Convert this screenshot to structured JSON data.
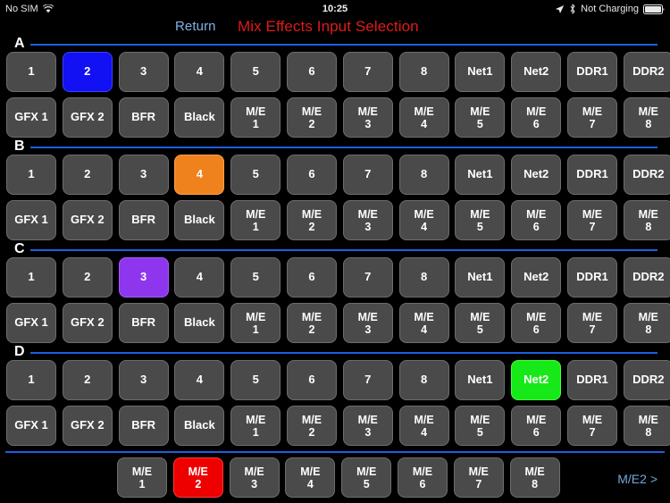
{
  "status_bar": {
    "carrier": "No SIM",
    "wifi_icon": "wifi-icon",
    "time": "10:25",
    "location_icon": "location-arrow-icon",
    "bluetooth_icon": "bluetooth-icon",
    "charging_status": "Not Charging",
    "battery_icon": "battery-icon"
  },
  "header": {
    "return_label": "Return",
    "title": "Mix Effects Input Selection",
    "return_color": "#7fb2e5",
    "title_color": "#e01a1a"
  },
  "theme": {
    "background": "#000000",
    "button_fill": "#4a4a4a",
    "button_border": "#6d6d6d",
    "rule_color": "#1c5fe0",
    "sel_blue": "#1111f4",
    "sel_orange": "#f0821e",
    "sel_purple": "#8e36ee",
    "sel_green": "#17e817",
    "sel_red": "#ee0000"
  },
  "sections": [
    {
      "label": "A",
      "row1": [
        {
          "label": "1",
          "state": "off"
        },
        {
          "label": "2",
          "state": "blue"
        },
        {
          "label": "3",
          "state": "off"
        },
        {
          "label": "4",
          "state": "off"
        },
        {
          "label": "5",
          "state": "off"
        },
        {
          "label": "6",
          "state": "off"
        },
        {
          "label": "7",
          "state": "off"
        },
        {
          "label": "8",
          "state": "off"
        },
        {
          "label": "Net1",
          "state": "off"
        },
        {
          "label": "Net2",
          "state": "off"
        },
        {
          "label": "DDR1",
          "state": "off"
        },
        {
          "label": "DDR2",
          "state": "off"
        }
      ],
      "row2": [
        {
          "label": "GFX 1",
          "state": "off"
        },
        {
          "label": "GFX 2",
          "state": "off"
        },
        {
          "label": "BFR",
          "state": "off"
        },
        {
          "label": "Black",
          "state": "off"
        },
        {
          "label": "M/E\n1",
          "state": "off"
        },
        {
          "label": "M/E\n2",
          "state": "off"
        },
        {
          "label": "M/E\n3",
          "state": "off"
        },
        {
          "label": "M/E\n4",
          "state": "off"
        },
        {
          "label": "M/E\n5",
          "state": "off"
        },
        {
          "label": "M/E\n6",
          "state": "off"
        },
        {
          "label": "M/E\n7",
          "state": "off"
        },
        {
          "label": "M/E\n8",
          "state": "off"
        }
      ]
    },
    {
      "label": "B",
      "row1": [
        {
          "label": "1",
          "state": "off"
        },
        {
          "label": "2",
          "state": "off"
        },
        {
          "label": "3",
          "state": "off"
        },
        {
          "label": "4",
          "state": "orange"
        },
        {
          "label": "5",
          "state": "off"
        },
        {
          "label": "6",
          "state": "off"
        },
        {
          "label": "7",
          "state": "off"
        },
        {
          "label": "8",
          "state": "off"
        },
        {
          "label": "Net1",
          "state": "off"
        },
        {
          "label": "Net2",
          "state": "off"
        },
        {
          "label": "DDR1",
          "state": "off"
        },
        {
          "label": "DDR2",
          "state": "off"
        }
      ],
      "row2": [
        {
          "label": "GFX 1",
          "state": "off"
        },
        {
          "label": "GFX 2",
          "state": "off"
        },
        {
          "label": "BFR",
          "state": "off"
        },
        {
          "label": "Black",
          "state": "off"
        },
        {
          "label": "M/E\n1",
          "state": "off"
        },
        {
          "label": "M/E\n2",
          "state": "off"
        },
        {
          "label": "M/E\n3",
          "state": "off"
        },
        {
          "label": "M/E\n4",
          "state": "off"
        },
        {
          "label": "M/E\n5",
          "state": "off"
        },
        {
          "label": "M/E\n6",
          "state": "off"
        },
        {
          "label": "M/E\n7",
          "state": "off"
        },
        {
          "label": "M/E\n8",
          "state": "off"
        }
      ]
    },
    {
      "label": "C",
      "row1": [
        {
          "label": "1",
          "state": "off"
        },
        {
          "label": "2",
          "state": "off"
        },
        {
          "label": "3",
          "state": "purple"
        },
        {
          "label": "4",
          "state": "off"
        },
        {
          "label": "5",
          "state": "off"
        },
        {
          "label": "6",
          "state": "off"
        },
        {
          "label": "7",
          "state": "off"
        },
        {
          "label": "8",
          "state": "off"
        },
        {
          "label": "Net1",
          "state": "off"
        },
        {
          "label": "Net2",
          "state": "off"
        },
        {
          "label": "DDR1",
          "state": "off"
        },
        {
          "label": "DDR2",
          "state": "off"
        }
      ],
      "row2": [
        {
          "label": "GFX 1",
          "state": "off"
        },
        {
          "label": "GFX 2",
          "state": "off"
        },
        {
          "label": "BFR",
          "state": "off"
        },
        {
          "label": "Black",
          "state": "off"
        },
        {
          "label": "M/E\n1",
          "state": "off"
        },
        {
          "label": "M/E\n2",
          "state": "off"
        },
        {
          "label": "M/E\n3",
          "state": "off"
        },
        {
          "label": "M/E\n4",
          "state": "off"
        },
        {
          "label": "M/E\n5",
          "state": "off"
        },
        {
          "label": "M/E\n6",
          "state": "off"
        },
        {
          "label": "M/E\n7",
          "state": "off"
        },
        {
          "label": "M/E\n8",
          "state": "off"
        }
      ]
    },
    {
      "label": "D",
      "row1": [
        {
          "label": "1",
          "state": "off"
        },
        {
          "label": "2",
          "state": "off"
        },
        {
          "label": "3",
          "state": "off"
        },
        {
          "label": "4",
          "state": "off"
        },
        {
          "label": "5",
          "state": "off"
        },
        {
          "label": "6",
          "state": "off"
        },
        {
          "label": "7",
          "state": "off"
        },
        {
          "label": "8",
          "state": "off"
        },
        {
          "label": "Net1",
          "state": "off"
        },
        {
          "label": "Net2",
          "state": "green"
        },
        {
          "label": "DDR1",
          "state": "off"
        },
        {
          "label": "DDR2",
          "state": "off"
        }
      ],
      "row2": [
        {
          "label": "GFX 1",
          "state": "off"
        },
        {
          "label": "GFX 2",
          "state": "off"
        },
        {
          "label": "BFR",
          "state": "off"
        },
        {
          "label": "Black",
          "state": "off"
        },
        {
          "label": "M/E\n1",
          "state": "off"
        },
        {
          "label": "M/E\n2",
          "state": "off"
        },
        {
          "label": "M/E\n3",
          "state": "off"
        },
        {
          "label": "M/E\n4",
          "state": "off"
        },
        {
          "label": "M/E\n5",
          "state": "off"
        },
        {
          "label": "M/E\n6",
          "state": "off"
        },
        {
          "label": "M/E\n7",
          "state": "off"
        },
        {
          "label": "M/E\n8",
          "state": "off"
        }
      ]
    }
  ],
  "footer": {
    "buttons": [
      {
        "label": "M/E\n1",
        "state": "off"
      },
      {
        "label": "M/E\n2",
        "state": "red"
      },
      {
        "label": "M/E\n3",
        "state": "off"
      },
      {
        "label": "M/E\n4",
        "state": "off"
      },
      {
        "label": "M/E\n5",
        "state": "off"
      },
      {
        "label": "M/E\n6",
        "state": "off"
      },
      {
        "label": "M/E\n7",
        "state": "off"
      },
      {
        "label": "M/E\n8",
        "state": "off"
      }
    ],
    "me_link": "M/E2 >"
  }
}
